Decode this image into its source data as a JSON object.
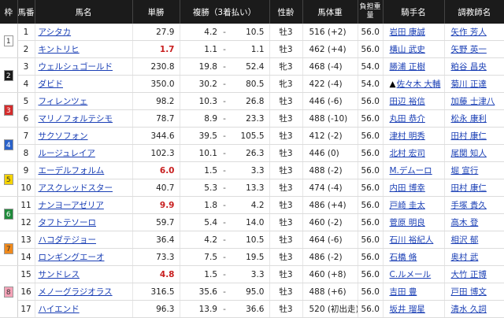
{
  "headers": {
    "waku": "枠",
    "umaban": "馬番",
    "name": "馬名",
    "odds": "単勝",
    "place": "複勝（3着払い）",
    "sexage": "性齢",
    "weight": "馬体重",
    "burden": "負担重量",
    "jockey": "騎手名",
    "trainer": "調教師名"
  },
  "waku_styles": {
    "1": {
      "bg": "#ffffff",
      "fg": "#333333"
    },
    "2": {
      "bg": "#1a1a1a",
      "fg": "#ffffff"
    },
    "3": {
      "bg": "#d42b2b",
      "fg": "#ffffff"
    },
    "4": {
      "bg": "#2a62c9",
      "fg": "#ffffff"
    },
    "5": {
      "bg": "#f5d300",
      "fg": "#333333"
    },
    "6": {
      "bg": "#1f8a3b",
      "fg": "#ffffff"
    },
    "7": {
      "bg": "#f08a1c",
      "fg": "#333333"
    },
    "8": {
      "bg": "#f5a3b8",
      "fg": "#333333"
    }
  },
  "rows": [
    {
      "waku": "1",
      "umaban": "1",
      "name": "アシタカ",
      "odds": "27.9",
      "fav": false,
      "pmin": "4.2",
      "pmax": "10.5",
      "sexage": "牡3",
      "weight": "516 (+2)",
      "burden": "56.0",
      "jockey_mark": "",
      "jockey": "岩田 康誠",
      "trainer": "矢作 芳人"
    },
    {
      "waku": "",
      "umaban": "2",
      "name": "キントリヒ",
      "odds": "1.7",
      "fav": true,
      "pmin": "1.1",
      "pmax": "1.1",
      "sexage": "牡3",
      "weight": "462 (+4)",
      "burden": "56.0",
      "jockey_mark": "",
      "jockey": "横山 武史",
      "trainer": "矢野 英一"
    },
    {
      "waku": "2",
      "umaban": "3",
      "name": "ウェルシュゴールド",
      "odds": "230.8",
      "fav": false,
      "pmin": "19.8",
      "pmax": "52.4",
      "sexage": "牝3",
      "weight": "468 (-4)",
      "burden": "54.0",
      "jockey_mark": "",
      "jockey": "勝浦 正樹",
      "trainer": "粕谷 昌央"
    },
    {
      "waku": "",
      "umaban": "4",
      "name": "ダビド",
      "odds": "350.0",
      "fav": false,
      "pmin": "30.2",
      "pmax": "80.5",
      "sexage": "牝3",
      "weight": "422 (-4)",
      "burden": "54.0",
      "jockey_mark": "▲",
      "jockey": "佐々木 大輔",
      "trainer": "菊川 正達"
    },
    {
      "waku": "3",
      "umaban": "5",
      "name": "フィレンツェ",
      "odds": "98.2",
      "fav": false,
      "pmin": "10.3",
      "pmax": "26.8",
      "sexage": "牡3",
      "weight": "446 (-6)",
      "burden": "56.0",
      "jockey_mark": "",
      "jockey": "田辺 裕信",
      "trainer": "加藤 士津八"
    },
    {
      "waku": "",
      "umaban": "6",
      "name": "マリノフォルテシモ",
      "odds": "78.7",
      "fav": false,
      "pmin": "8.9",
      "pmax": "23.3",
      "sexage": "牡3",
      "weight": "488 (-10)",
      "burden": "56.0",
      "jockey_mark": "",
      "jockey": "丸田 恭介",
      "trainer": "松永 康利"
    },
    {
      "waku": "4",
      "umaban": "7",
      "name": "サクソフォン",
      "odds": "344.6",
      "fav": false,
      "pmin": "39.5",
      "pmax": "105.5",
      "sexage": "牡3",
      "weight": "412 (-2)",
      "burden": "56.0",
      "jockey_mark": "",
      "jockey": "津村 明秀",
      "trainer": "田村 康仁"
    },
    {
      "waku": "",
      "umaban": "8",
      "name": "ルージュレイア",
      "odds": "102.3",
      "fav": false,
      "pmin": "10.1",
      "pmax": "26.3",
      "sexage": "牡3",
      "weight": "446 (0)",
      "burden": "56.0",
      "jockey_mark": "",
      "jockey": "北村 宏司",
      "trainer": "尾関 知人"
    },
    {
      "waku": "5",
      "umaban": "9",
      "name": "エーデルフォルム",
      "odds": "6.0",
      "fav": true,
      "pmin": "1.5",
      "pmax": "3.3",
      "sexage": "牡3",
      "weight": "488 (-2)",
      "burden": "56.0",
      "jockey_mark": "",
      "jockey": "M.デムーロ",
      "trainer": "堀 宣行"
    },
    {
      "waku": "",
      "umaban": "10",
      "name": "アスクレッドスター",
      "odds": "40.7",
      "fav": false,
      "pmin": "5.3",
      "pmax": "13.3",
      "sexage": "牡3",
      "weight": "474 (-4)",
      "burden": "56.0",
      "jockey_mark": "",
      "jockey": "内田 博幸",
      "trainer": "田村 康仁"
    },
    {
      "waku": "6",
      "umaban": "11",
      "name": "ナンヨーアゼリア",
      "odds": "9.9",
      "fav": true,
      "pmin": "1.8",
      "pmax": "4.2",
      "sexage": "牡3",
      "weight": "486 (+4)",
      "burden": "56.0",
      "jockey_mark": "",
      "jockey": "戸崎 圭太",
      "trainer": "手塚 貴久"
    },
    {
      "waku": "",
      "umaban": "12",
      "name": "タフトテソーロ",
      "odds": "59.7",
      "fav": false,
      "pmin": "5.4",
      "pmax": "14.0",
      "sexage": "牡3",
      "weight": "460 (-2)",
      "burden": "56.0",
      "jockey_mark": "",
      "jockey": "菅原 明良",
      "trainer": "高木 登"
    },
    {
      "waku": "7",
      "umaban": "13",
      "name": "ハコダテジョー",
      "odds": "36.4",
      "fav": false,
      "pmin": "4.2",
      "pmax": "10.5",
      "sexage": "牡3",
      "weight": "464 (-6)",
      "burden": "56.0",
      "jockey_mark": "",
      "jockey": "石川 裕紀人",
      "trainer": "相沢 郁"
    },
    {
      "waku": "",
      "umaban": "14",
      "name": "ロンギングエーオ",
      "odds": "73.3",
      "fav": false,
      "pmin": "7.5",
      "pmax": "19.5",
      "sexage": "牡3",
      "weight": "486 (-2)",
      "burden": "56.0",
      "jockey_mark": "",
      "jockey": "石橋 脩",
      "trainer": "奥村 武"
    },
    {
      "waku": "8",
      "umaban": "15",
      "name": "サンドレス",
      "odds": "4.8",
      "fav": true,
      "pmin": "1.5",
      "pmax": "3.3",
      "sexage": "牡3",
      "weight": "460 (+8)",
      "burden": "56.0",
      "jockey_mark": "",
      "jockey": "C.ルメール",
      "trainer": "大竹 正博"
    },
    {
      "waku": "",
      "umaban": "16",
      "name": "メノーグラジオラス",
      "odds": "316.5",
      "fav": false,
      "pmin": "35.6",
      "pmax": "95.0",
      "sexage": "牡3",
      "weight": "488 (+6)",
      "burden": "56.0",
      "jockey_mark": "",
      "jockey": "吉田 豊",
      "trainer": "戸田 博文"
    },
    {
      "waku": "",
      "umaban": "17",
      "name": "ハイエンド",
      "odds": "96.3",
      "fav": false,
      "pmin": "13.9",
      "pmax": "36.6",
      "sexage": "牡3",
      "weight": "520 (初出走)",
      "burden": "56.0",
      "jockey_mark": "",
      "jockey": "坂井 瑠星",
      "trainer": "清水 久詞"
    }
  ]
}
